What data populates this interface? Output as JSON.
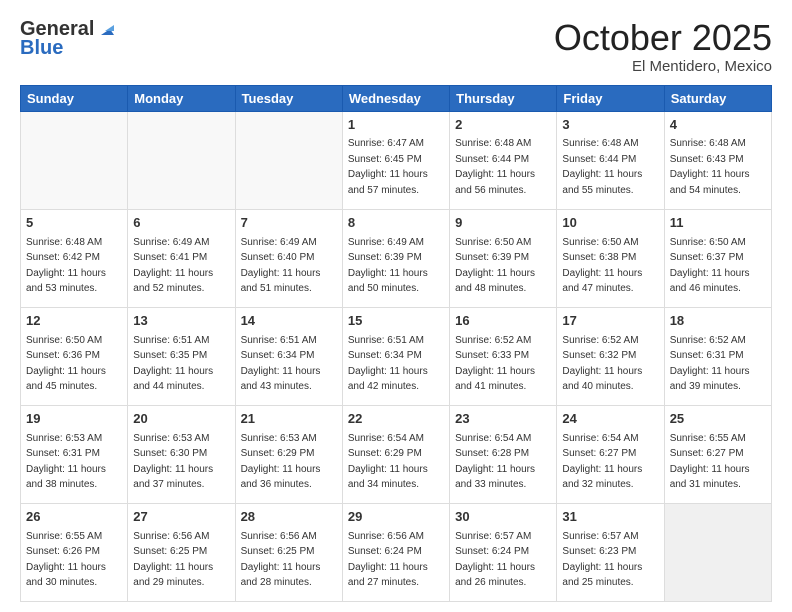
{
  "header": {
    "logo_general": "General",
    "logo_blue": "Blue",
    "month_title": "October 2025",
    "location": "El Mentidero, Mexico"
  },
  "days_of_week": [
    "Sunday",
    "Monday",
    "Tuesday",
    "Wednesday",
    "Thursday",
    "Friday",
    "Saturday"
  ],
  "weeks": [
    [
      {
        "day": "",
        "info": ""
      },
      {
        "day": "",
        "info": ""
      },
      {
        "day": "",
        "info": ""
      },
      {
        "day": "1",
        "info": "Sunrise: 6:47 AM\nSunset: 6:45 PM\nDaylight: 11 hours\nand 57 minutes."
      },
      {
        "day": "2",
        "info": "Sunrise: 6:48 AM\nSunset: 6:44 PM\nDaylight: 11 hours\nand 56 minutes."
      },
      {
        "day": "3",
        "info": "Sunrise: 6:48 AM\nSunset: 6:44 PM\nDaylight: 11 hours\nand 55 minutes."
      },
      {
        "day": "4",
        "info": "Sunrise: 6:48 AM\nSunset: 6:43 PM\nDaylight: 11 hours\nand 54 minutes."
      }
    ],
    [
      {
        "day": "5",
        "info": "Sunrise: 6:48 AM\nSunset: 6:42 PM\nDaylight: 11 hours\nand 53 minutes."
      },
      {
        "day": "6",
        "info": "Sunrise: 6:49 AM\nSunset: 6:41 PM\nDaylight: 11 hours\nand 52 minutes."
      },
      {
        "day": "7",
        "info": "Sunrise: 6:49 AM\nSunset: 6:40 PM\nDaylight: 11 hours\nand 51 minutes."
      },
      {
        "day": "8",
        "info": "Sunrise: 6:49 AM\nSunset: 6:39 PM\nDaylight: 11 hours\nand 50 minutes."
      },
      {
        "day": "9",
        "info": "Sunrise: 6:50 AM\nSunset: 6:39 PM\nDaylight: 11 hours\nand 48 minutes."
      },
      {
        "day": "10",
        "info": "Sunrise: 6:50 AM\nSunset: 6:38 PM\nDaylight: 11 hours\nand 47 minutes."
      },
      {
        "day": "11",
        "info": "Sunrise: 6:50 AM\nSunset: 6:37 PM\nDaylight: 11 hours\nand 46 minutes."
      }
    ],
    [
      {
        "day": "12",
        "info": "Sunrise: 6:50 AM\nSunset: 6:36 PM\nDaylight: 11 hours\nand 45 minutes."
      },
      {
        "day": "13",
        "info": "Sunrise: 6:51 AM\nSunset: 6:35 PM\nDaylight: 11 hours\nand 44 minutes."
      },
      {
        "day": "14",
        "info": "Sunrise: 6:51 AM\nSunset: 6:34 PM\nDaylight: 11 hours\nand 43 minutes."
      },
      {
        "day": "15",
        "info": "Sunrise: 6:51 AM\nSunset: 6:34 PM\nDaylight: 11 hours\nand 42 minutes."
      },
      {
        "day": "16",
        "info": "Sunrise: 6:52 AM\nSunset: 6:33 PM\nDaylight: 11 hours\nand 41 minutes."
      },
      {
        "day": "17",
        "info": "Sunrise: 6:52 AM\nSunset: 6:32 PM\nDaylight: 11 hours\nand 40 minutes."
      },
      {
        "day": "18",
        "info": "Sunrise: 6:52 AM\nSunset: 6:31 PM\nDaylight: 11 hours\nand 39 minutes."
      }
    ],
    [
      {
        "day": "19",
        "info": "Sunrise: 6:53 AM\nSunset: 6:31 PM\nDaylight: 11 hours\nand 38 minutes."
      },
      {
        "day": "20",
        "info": "Sunrise: 6:53 AM\nSunset: 6:30 PM\nDaylight: 11 hours\nand 37 minutes."
      },
      {
        "day": "21",
        "info": "Sunrise: 6:53 AM\nSunset: 6:29 PM\nDaylight: 11 hours\nand 36 minutes."
      },
      {
        "day": "22",
        "info": "Sunrise: 6:54 AM\nSunset: 6:29 PM\nDaylight: 11 hours\nand 34 minutes."
      },
      {
        "day": "23",
        "info": "Sunrise: 6:54 AM\nSunset: 6:28 PM\nDaylight: 11 hours\nand 33 minutes."
      },
      {
        "day": "24",
        "info": "Sunrise: 6:54 AM\nSunset: 6:27 PM\nDaylight: 11 hours\nand 32 minutes."
      },
      {
        "day": "25",
        "info": "Sunrise: 6:55 AM\nSunset: 6:27 PM\nDaylight: 11 hours\nand 31 minutes."
      }
    ],
    [
      {
        "day": "26",
        "info": "Sunrise: 6:55 AM\nSunset: 6:26 PM\nDaylight: 11 hours\nand 30 minutes."
      },
      {
        "day": "27",
        "info": "Sunrise: 6:56 AM\nSunset: 6:25 PM\nDaylight: 11 hours\nand 29 minutes."
      },
      {
        "day": "28",
        "info": "Sunrise: 6:56 AM\nSunset: 6:25 PM\nDaylight: 11 hours\nand 28 minutes."
      },
      {
        "day": "29",
        "info": "Sunrise: 6:56 AM\nSunset: 6:24 PM\nDaylight: 11 hours\nand 27 minutes."
      },
      {
        "day": "30",
        "info": "Sunrise: 6:57 AM\nSunset: 6:24 PM\nDaylight: 11 hours\nand 26 minutes."
      },
      {
        "day": "31",
        "info": "Sunrise: 6:57 AM\nSunset: 6:23 PM\nDaylight: 11 hours\nand 25 minutes."
      },
      {
        "day": "",
        "info": ""
      }
    ]
  ]
}
